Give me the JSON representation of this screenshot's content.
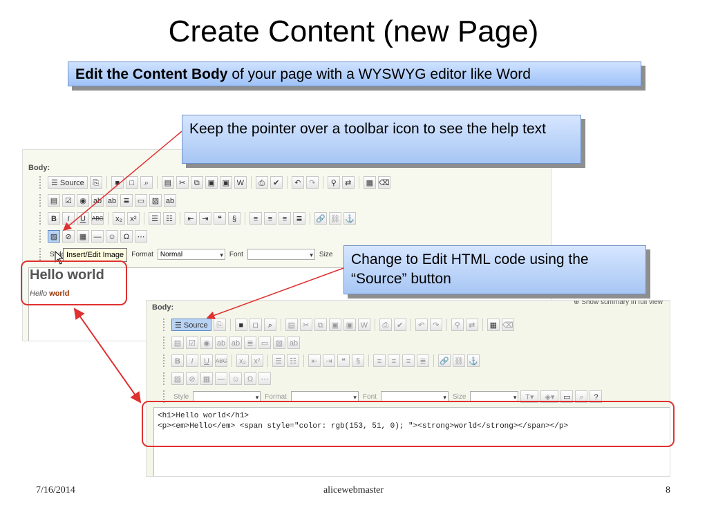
{
  "slide": {
    "title": "Create Content (new Page)",
    "banner_bold": "Edit the Content Body",
    "banner_rest": " of your page with a WYSWYG editor like Word",
    "callout_pointer": "Keep the pointer over a toolbar icon to see the help text",
    "callout_source": "Change to Edit HTML code  using the “Source” button",
    "footer_date": "7/16/2014",
    "footer_author": "alicewebmaster",
    "footer_page": "8"
  },
  "editor1": {
    "body_label": "Body:",
    "source_button": "Source",
    "tooltip": "Insert/Edit Image",
    "style_label": "Style",
    "format_label": "Format",
    "format_value": "Normal",
    "font_label": "Font",
    "size_label": "Size",
    "heading_text": "Hello world",
    "para_em": "Hello",
    "para_strong": "world"
  },
  "editor2": {
    "body_label": "Body:",
    "summary_link": "Show summary in full view",
    "source_button": "Source",
    "style_label": "Style",
    "format_label": "Format",
    "font_label": "Font",
    "size_label": "Size",
    "code_line1": "<h1>Hello world</h1>",
    "code_line2": "<p><em>Hello</em> <span style=\"color: rgb(153, 51, 0); \"><strong>world</strong></span></p>"
  },
  "colors": {
    "accent_red": "#e03030",
    "world_color": "#993300",
    "callout_blue": "#a7c6f4"
  }
}
